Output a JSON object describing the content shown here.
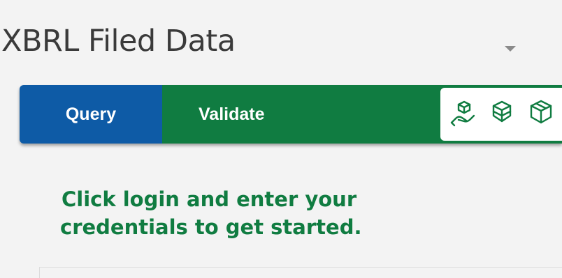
{
  "header": {
    "title": "XBRL Filed Data",
    "menu_icon": "caret-down-icon"
  },
  "tabs": [
    {
      "label": "Query",
      "color": "#0e5ba6"
    },
    {
      "label": "Validate",
      "color": "#107c41"
    }
  ],
  "toolbar_icons": [
    "hand-cube-icon",
    "cube-arrow-icon",
    "cube-outline-icon"
  ],
  "message": {
    "line1": "Click login and enter your",
    "line2": "credentials to get started."
  },
  "colors": {
    "accent_green": "#107c41",
    "accent_blue": "#0e5ba6"
  }
}
